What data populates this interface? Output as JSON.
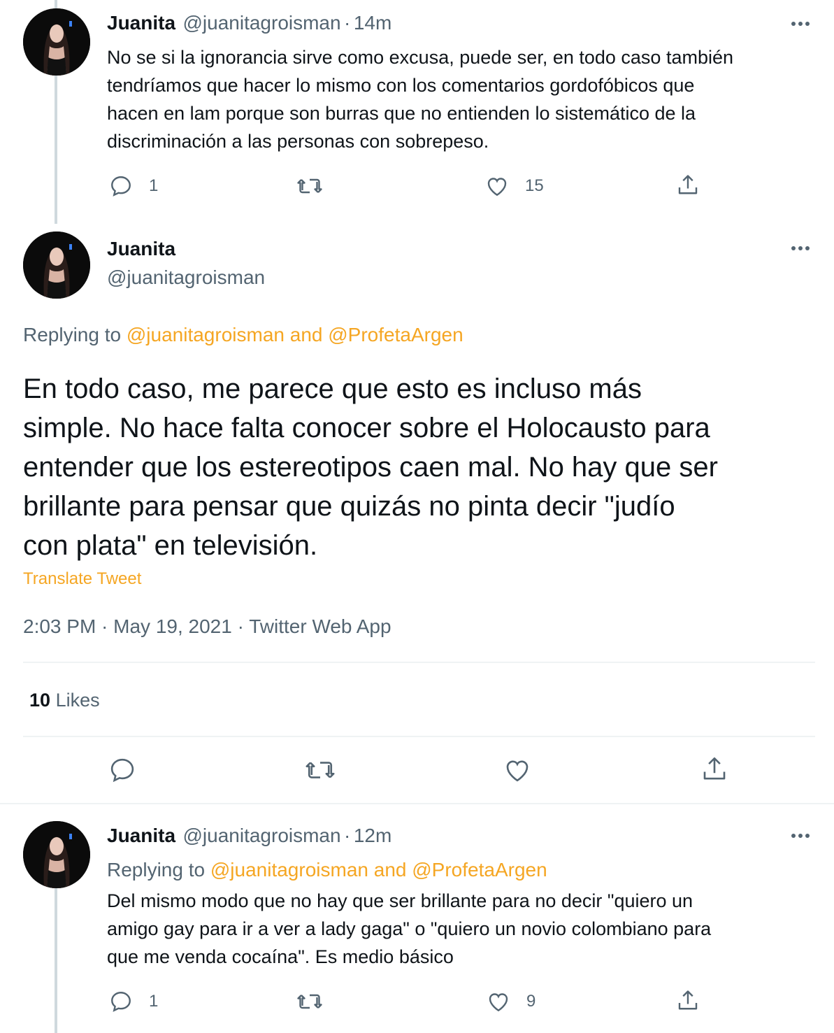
{
  "tweet1": {
    "name": "Juanita",
    "handle": "@juanitagroisman",
    "sep": "·",
    "time": "14m",
    "text_lines": [
      "No se si la ignorancia sirve como excusa, puede ser, en todo caso también",
      "tendríamos que hacer lo mismo con los comentarios gordofóbicos que",
      "hacen en lam porque son burras que no entienden lo sistemático de la",
      "discriminación a las personas con sobrepeso."
    ],
    "replies": "1",
    "likes": "15"
  },
  "main": {
    "name": "Juanita",
    "handle": "@juanitagroisman",
    "replying_label": "Replying to",
    "replying_to": "@juanitagroisman and @ProfetaArgen",
    "text_lines": [
      "En todo caso, me parece que esto es incluso más",
      "simple. No hace falta conocer sobre el Holocausto para",
      "entender que los estereotipos caen mal. No hay que ser",
      "brillante para pensar que quizás no pinta decir \"judío",
      "con plata\" en televisión."
    ],
    "translate": "Translate Tweet",
    "timestamp": "2:03 PM · May 19, 2021 · Twitter Web App",
    "likes_count": "10",
    "likes_label": "Likes"
  },
  "tweet3": {
    "name": "Juanita",
    "handle": "@juanitagroisman",
    "sep": "·",
    "time": "12m",
    "replying_label": "Replying to",
    "replying_to": "@juanitagroisman and @ProfetaArgen",
    "text_lines": [
      "Del mismo modo que no hay que ser brillante para no decir \"quiero un",
      "amigo gay para ir a ver a lady gaga\" o \"quiero un novio colombiano para",
      "que me venda cocaína\". Es medio básico"
    ],
    "replies": "1",
    "likes": "9"
  },
  "colors": {
    "accent": "#f5a623",
    "secondary": "#536471",
    "text": "#0f1419",
    "line": "#cfd9de"
  },
  "icons": [
    "reply-icon",
    "retweet-icon",
    "like-icon",
    "share-icon",
    "more-icon"
  ]
}
